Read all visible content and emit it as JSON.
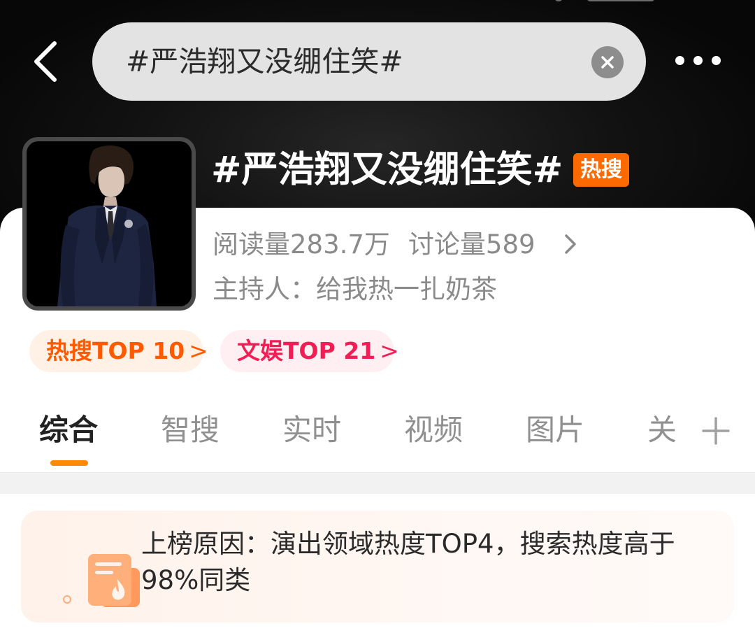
{
  "search": {
    "query": "#严浩翔又没绷住笑#"
  },
  "topic": {
    "title": "#严浩翔又没绷住笑#",
    "badge": "热搜",
    "reads": "阅读量283.7万",
    "discussions": "讨论量589",
    "host": "主持人：给我热一扎奶茶"
  },
  "rank_chips": [
    {
      "label": "热搜TOP 10",
      "arrow": ">"
    },
    {
      "label": "文娱TOP 21",
      "arrow": ">"
    }
  ],
  "tabs": [
    {
      "label": "综合",
      "active": true
    },
    {
      "label": "智搜"
    },
    {
      "label": "实时"
    },
    {
      "label": "视频"
    },
    {
      "label": "图片"
    },
    {
      "label": "关"
    }
  ],
  "reason": {
    "text": "上榜原因：演出领域热度TOP4，搜索热度高于98%同类"
  },
  "colors": {
    "accent": "#ff8a00",
    "hot_badge": "#ff6a00",
    "hot_chip_text": "#ff5a00",
    "ent_chip_text": "#f01e55"
  },
  "icons": [
    "back-arrow-icon",
    "clear-icon",
    "more-icon",
    "chevron-right-icon",
    "add-tab-icon",
    "hot-document-icon"
  ]
}
